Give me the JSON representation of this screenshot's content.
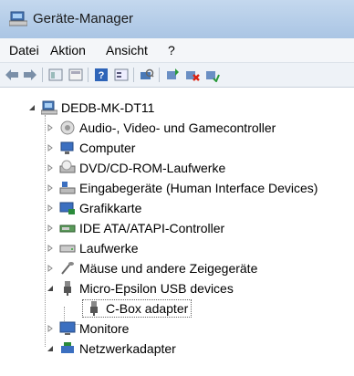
{
  "window": {
    "title": "Geräte-Manager"
  },
  "menu": [
    "Datei",
    "Aktion",
    "Ansicht",
    "?"
  ],
  "toolbar": [
    "back",
    "forward",
    "properties",
    "view",
    "help",
    "view-list",
    "scan",
    "update-driver",
    "uninstall",
    "enable"
  ],
  "tree": {
    "root": "DEDB-MK-DT11",
    "items": [
      {
        "label": "Audio-, Video- und Gamecontroller",
        "icon": "speaker-icon",
        "expanded": false
      },
      {
        "label": "Computer",
        "icon": "computer-icon",
        "expanded": false
      },
      {
        "label": "DVD/CD-ROM-Laufwerke",
        "icon": "dvd-drive-icon",
        "expanded": false
      },
      {
        "label": "Eingabegeräte (Human Interface Devices)",
        "icon": "hid-icon",
        "expanded": false
      },
      {
        "label": "Grafikkarte",
        "icon": "display-adapter-icon",
        "expanded": false
      },
      {
        "label": "IDE ATA/ATAPI-Controller",
        "icon": "ide-controller-icon",
        "expanded": false
      },
      {
        "label": "Laufwerke",
        "icon": "disk-drive-icon",
        "expanded": false
      },
      {
        "label": "Mäuse und andere Zeigegeräte",
        "icon": "mouse-icon",
        "expanded": false
      },
      {
        "label": "Micro-Epsilon USB devices",
        "icon": "usb-plug-icon",
        "expanded": true
      },
      {
        "label": "C-Box adapter",
        "icon": "usb-plug-icon",
        "child": true,
        "selected": true
      },
      {
        "label": "Monitore",
        "icon": "monitor-icon",
        "expanded": false
      },
      {
        "label": "Netzwerkadapter",
        "icon": "network-adapter-icon",
        "expanded": true
      }
    ]
  },
  "colors": {
    "titlebar": "#b6cde8",
    "selection_border": "#666666"
  }
}
